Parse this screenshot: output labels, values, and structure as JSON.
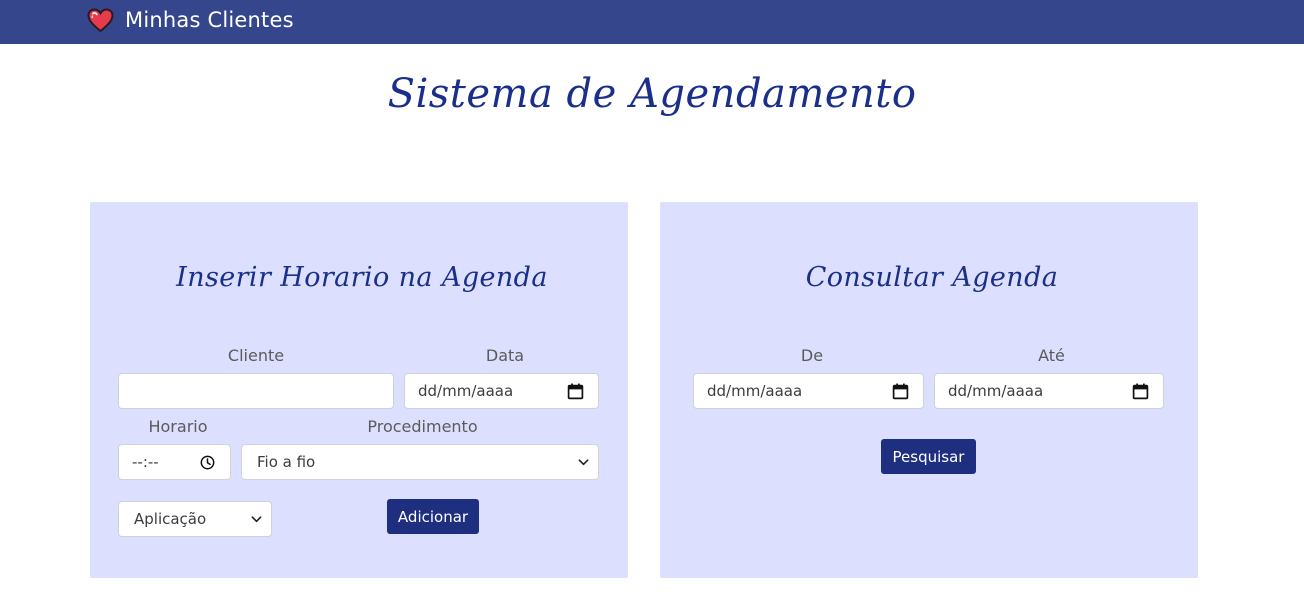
{
  "navbar": {
    "brand": "Minhas Clientes",
    "brand_icon": "heart-icon",
    "background": "#36468c"
  },
  "page": {
    "title": "Sistema de Agendamento",
    "title_color": "#1a2f8a",
    "panel_color": "#dcdffd"
  },
  "insert_panel": {
    "title": "Inserir Horario na Agenda",
    "cliente_label": "Cliente",
    "cliente_value": "",
    "data_label": "Data",
    "data_placeholder": "dd/mm/aaaa",
    "horario_label": "Horario",
    "horario_placeholder": "--:--",
    "procedimento_label": "Procedimento",
    "procedimento_selected": "Fio a fio",
    "tipo_selected": "Aplicação",
    "submit_label": "Adicionar",
    "button_color": "#1f2f80"
  },
  "search_panel": {
    "title": "Consultar Agenda",
    "de_label": "De",
    "de_placeholder": "dd/mm/aaaa",
    "ate_label": "Até",
    "ate_placeholder": "dd/mm/aaaa",
    "submit_label": "Pesquisar"
  }
}
